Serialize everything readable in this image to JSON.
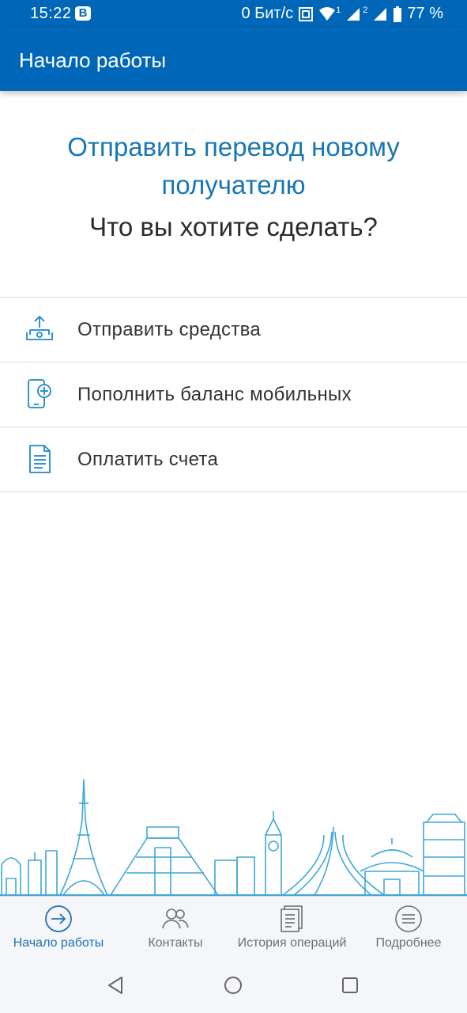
{
  "status_bar": {
    "time": "15:22",
    "app_badge": "B",
    "net_speed": "0 Бит/с",
    "sim1": "1",
    "sim2": "2",
    "battery": "77 %"
  },
  "app_bar": {
    "title": "Начало работы"
  },
  "main": {
    "headline": "Отправить перевод новому получателю",
    "question": "Что вы хотите сделать?"
  },
  "actions": [
    {
      "label": "Отправить средства",
      "icon": "send-money-icon"
    },
    {
      "label": "Пополнить баланс мобильных",
      "icon": "mobile-topup-icon"
    },
    {
      "label": "Оплатить счета",
      "icon": "bill-icon"
    }
  ],
  "bottom_nav": [
    {
      "label": "Начало работы",
      "icon": "arrow-circle-icon",
      "active": true
    },
    {
      "label": "Контакты",
      "icon": "contacts-icon",
      "active": false
    },
    {
      "label": "История операций",
      "icon": "history-icon",
      "active": false
    },
    {
      "label": "Подробнее",
      "icon": "menu-icon",
      "active": false
    }
  ],
  "colors": {
    "brand": "#0067b8",
    "accent": "#1976b5",
    "icon": "#1e88c8"
  }
}
